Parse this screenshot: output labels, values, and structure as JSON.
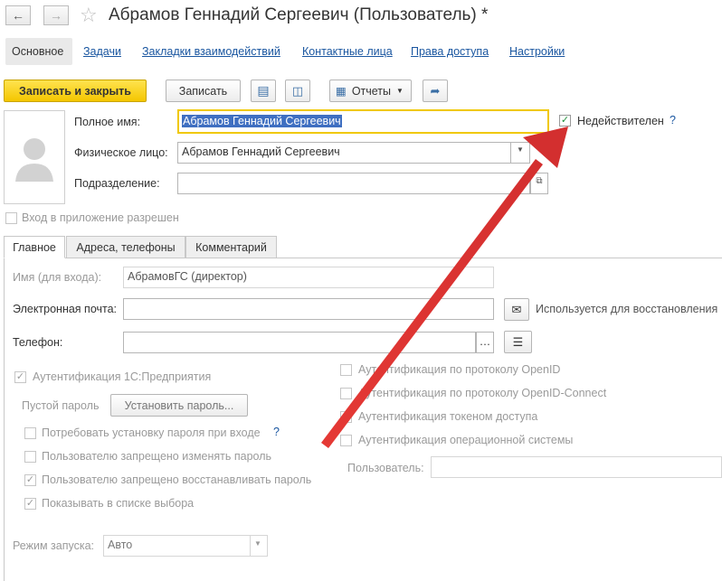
{
  "header": {
    "back_icon": "arrow-left-icon",
    "forward_icon": "arrow-right-icon",
    "favorite_icon": "star-icon",
    "title": "Абрамов Геннадий Сергеевич (Пользователь) *"
  },
  "nav_tabs": [
    {
      "label": "Основное"
    },
    {
      "label": "Задачи"
    },
    {
      "label": "Закладки взаимодействий"
    },
    {
      "label": "Контактные лица"
    },
    {
      "label": "Права доступа"
    },
    {
      "label": "Настройки"
    }
  ],
  "toolbar": {
    "save_close": "Записать и закрыть",
    "save": "Записать",
    "reports": "Отчеты"
  },
  "form": {
    "full_name_label": "Полное имя:",
    "full_name_value": "Абрамов Геннадий Сергеевич",
    "invalid_label": "Недействителен",
    "invalid_help": "?",
    "person_label": "Физическое лицо:",
    "person_value": "Абрамов Геннадий Сергеевич",
    "department_label": "Подразделение:",
    "department_value": "",
    "login_allowed_label": "Вход в приложение разрешен"
  },
  "inner_tabs": [
    {
      "label": "Главное"
    },
    {
      "label": "Адреса, телефоны"
    },
    {
      "label": "Комментарий"
    }
  ],
  "main_tab": {
    "login_name_label": "Имя (для входа):",
    "login_name_value": "АбрамовГС (директор)",
    "email_label": "Электронная почта:",
    "email_value": "",
    "email_hint": "Используется для восстановления",
    "phone_label": "Телефон:",
    "phone_value": "",
    "auth_1c": "Аутентификация 1С:Предприятия",
    "empty_password": "Пустой пароль",
    "set_password": "Установить пароль...",
    "require_password": "Потребовать установку пароля при входе",
    "require_help": "?",
    "forbid_change": "Пользователю запрещено изменять пароль",
    "forbid_restore": "Пользователю запрещено восстанавливать пароль",
    "show_in_list": "Показывать в списке выбора",
    "auth_openid": "Аутентификация по протоколу OpenID",
    "auth_openid_connect": "Аутентификация по протоколу OpenID-Connect",
    "auth_token": "Аутентификация токеном доступа",
    "auth_os": "Аутентификация операционной системы",
    "os_user_label": "Пользователь:",
    "os_user_value": "",
    "launch_mode_label": "Режим запуска:",
    "launch_mode_value": "Авто"
  },
  "colors": {
    "primary_button": "#f4c600",
    "link": "#1a56a0",
    "annotation_arrow": "#e53935",
    "selection": "#3f6fc1"
  }
}
